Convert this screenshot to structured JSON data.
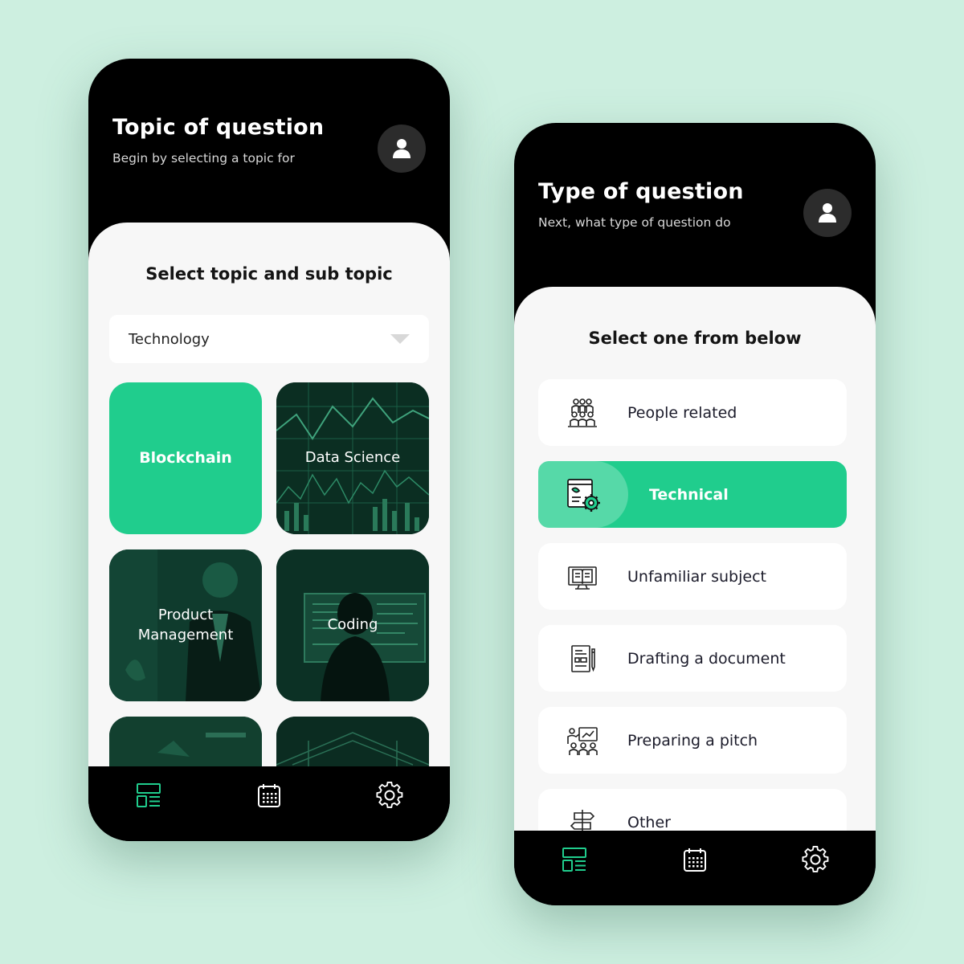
{
  "colors": {
    "accent": "#20cd8d",
    "background": "#cdefe0",
    "header": "#000000",
    "panel": "#f7f7f7"
  },
  "screen1": {
    "title": "Topic of question",
    "subtitle": "Begin by selecting a topic for",
    "panel_title": "Select topic and sub topic",
    "dropdown": {
      "selected": "Technology"
    },
    "tiles": [
      {
        "label": "Blockchain",
        "selected": true
      },
      {
        "label": "Data Science",
        "selected": false
      },
      {
        "label": "Product Management",
        "selected": false
      },
      {
        "label": "Coding",
        "selected": false
      },
      {
        "label": "",
        "selected": false
      },
      {
        "label": "",
        "selected": false
      }
    ]
  },
  "screen2": {
    "title": "Type of question",
    "subtitle": "Next, what type of question do",
    "panel_title": "Select one from below",
    "options": [
      {
        "label": "People related",
        "icon": "people-group-icon",
        "selected": false
      },
      {
        "label": "Technical",
        "icon": "blueprint-gear-icon",
        "selected": true
      },
      {
        "label": "Unfamiliar subject",
        "icon": "book-monitor-icon",
        "selected": false
      },
      {
        "label": "Drafting a document",
        "icon": "document-pen-icon",
        "selected": false
      },
      {
        "label": "Preparing a pitch",
        "icon": "presentation-icon",
        "selected": false
      },
      {
        "label": "Other",
        "icon": "signpost-icon",
        "selected": false
      }
    ]
  },
  "navbar": {
    "items": [
      {
        "icon": "dashboard-icon",
        "active": true
      },
      {
        "icon": "calendar-icon",
        "active": false
      },
      {
        "icon": "gear-icon",
        "active": false
      }
    ]
  }
}
